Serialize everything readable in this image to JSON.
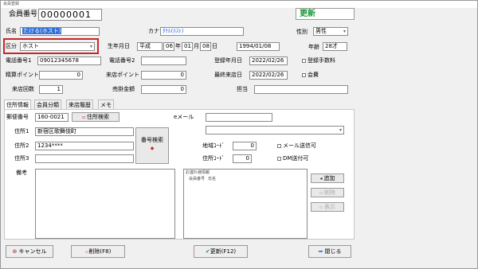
{
  "window": {
    "title": "会員登録"
  },
  "header": {
    "member_no_label": "会員番号",
    "member_no": "00000001",
    "status": "更新"
  },
  "form": {
    "name_label": "氏名",
    "name_value": "たける(ホスト)",
    "kana_label": "カナ",
    "kana_value": "ﾀｹﾙ(ﾎｽﾄ)",
    "gender_label": "性別",
    "gender_value": "男性",
    "category_label": "区分",
    "category_value": "ホスト",
    "birth_label": "生年月日",
    "era": "平成",
    "year": "06",
    "year_unit": "年",
    "month": "01",
    "month_unit": "月",
    "day": "08",
    "day_unit": "日",
    "birth_iso": "1994/01/08",
    "age_label": "年齢",
    "age": "28才",
    "phone1_label": "電話番号1",
    "phone1": "09012345678",
    "phone2_label": "電話番号2",
    "phone2": "",
    "reg_date_label": "登録年月日",
    "reg_date": "2022/02/26",
    "reg_fee_label": "登録手数料",
    "points_calc_label": "精算ポイント",
    "points_calc": "0",
    "visit_points_label": "来店ポイント",
    "visit_points": "0",
    "last_visit_label": "最終来店日",
    "last_visit": "2022/02/26",
    "membership_label": "会費",
    "visits_label": "来店回数",
    "visits": "1",
    "credit_label": "売掛金額",
    "credit": "0",
    "staff_label": "担当",
    "staff": ""
  },
  "tabs": [
    "住所情報",
    "会員分類",
    "来店履歴",
    "メモ"
  ],
  "address": {
    "postal_label": "郵便番号",
    "postal": "160-0021",
    "address_search_label": "住所検索",
    "addr1_label": "住所1",
    "addr1": "新宿区歌舞伎町",
    "addr2_label": "住所2",
    "addr2": "1234****",
    "addr3_label": "住所3",
    "addr3": "",
    "number_search_label": "番号検索",
    "email_label": "eメール",
    "email": "",
    "region_label": "地域ｺｰﾄﾞ",
    "region": "0",
    "addr_code_label": "住所ｺｰﾄﾞ",
    "addr_code": "0",
    "mail_ok_label": "メール送信可",
    "dm_ok_label": "DM送付可",
    "notes_label": "備考",
    "companion_title": "お連れ様情報",
    "companion_cols": [
      "会員番号",
      "氏名"
    ],
    "add_label": "追加",
    "delete_label": "削除",
    "show_label": "表示"
  },
  "footer": {
    "cancel": "キャンセル",
    "delete": "削除(F8)",
    "update": "更新(F12)",
    "close": "閉じる"
  },
  "colors": {
    "status_green": "#1a9a3a",
    "highlight_red": "#c62828",
    "selection_blue": "#2f6fd6"
  }
}
